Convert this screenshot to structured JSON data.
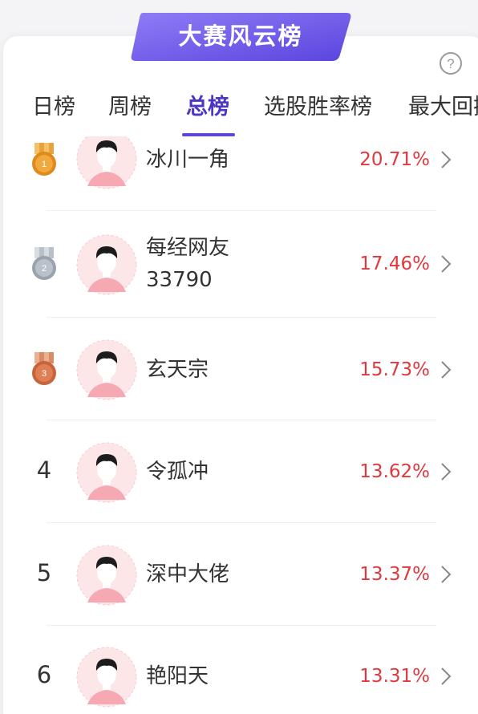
{
  "banner": {
    "title": "大赛风云榜"
  },
  "help": {
    "icon": "help-circle-icon",
    "glyph": "?"
  },
  "tabs": [
    {
      "label": "日榜",
      "active": false
    },
    {
      "label": "周榜",
      "active": false
    },
    {
      "label": "总榜",
      "active": true
    },
    {
      "label": "选股胜率榜",
      "active": false
    },
    {
      "label": "最大回撤",
      "active": false
    }
  ],
  "colors": {
    "accent": "#5b46d6",
    "rate_red": "#e2373d",
    "gold": "#e08a1c",
    "silver": "#9aa3ad",
    "bronze": "#c7643c",
    "avatar_bg": "#fde6e8"
  },
  "rankings": [
    {
      "rank": "1",
      "medal": "gold",
      "name_lines": [
        "冰川一角"
      ],
      "rate": "20.71%"
    },
    {
      "rank": "2",
      "medal": "silver",
      "name_lines": [
        "每经网友",
        "33790"
      ],
      "rate": "17.46%"
    },
    {
      "rank": "3",
      "medal": "bronze",
      "name_lines": [
        "玄天宗"
      ],
      "rate": "15.73%"
    },
    {
      "rank": "4",
      "medal": null,
      "name_lines": [
        "令孤冲"
      ],
      "rate": "13.62%"
    },
    {
      "rank": "5",
      "medal": null,
      "name_lines": [
        "深中大佬"
      ],
      "rate": "13.37%"
    },
    {
      "rank": "6",
      "medal": null,
      "name_lines": [
        "艳阳天"
      ],
      "rate": "13.31%"
    }
  ]
}
